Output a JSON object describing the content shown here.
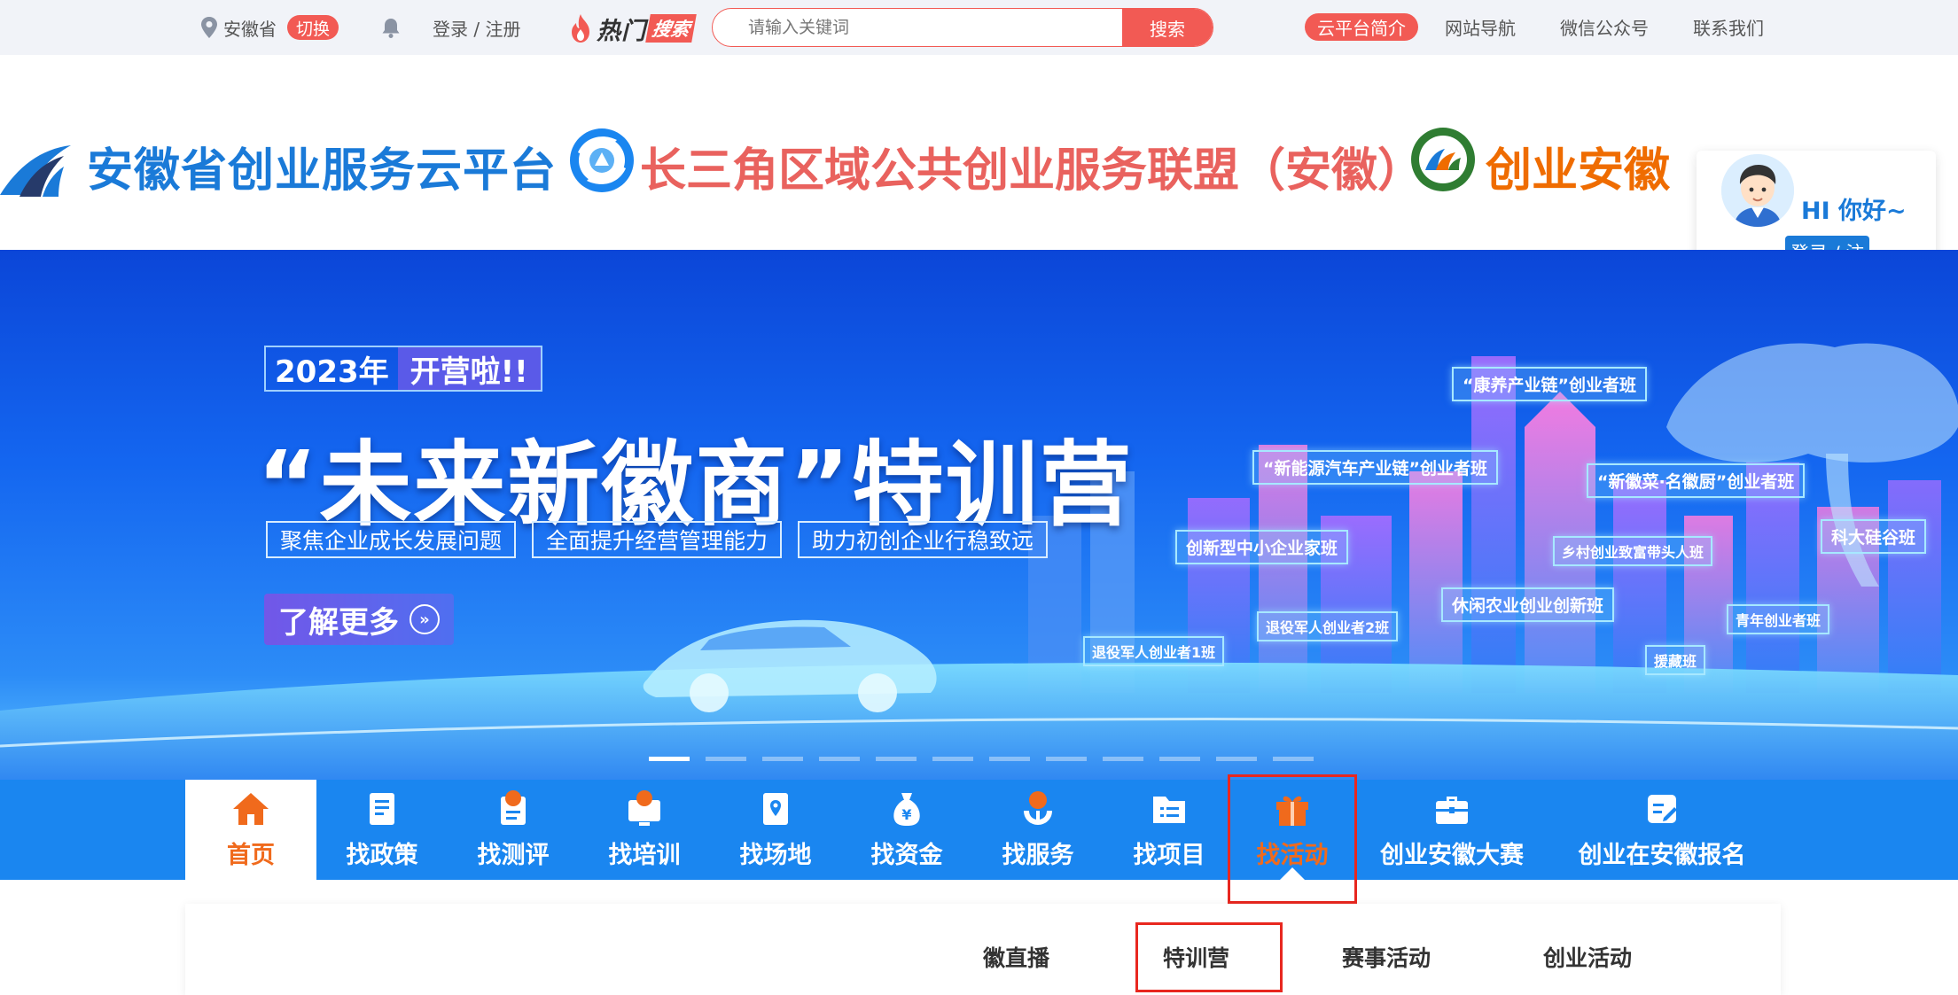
{
  "topbar": {
    "location": "安徽省",
    "switch_label": "切换",
    "login_label": "登录 / 注册",
    "hot_label": "热门",
    "hot_tag": "搜索",
    "search_placeholder": "请输入关键词",
    "search_button": "搜索",
    "intro_label": "云平台简介",
    "links": [
      "网站导航",
      "微信公众号",
      "联系我们"
    ]
  },
  "header": {
    "brand_1": "安徽省创业服务云平台",
    "brand_2": "长三角区域公共创业服务联盟（安徽）",
    "brand_3": "创业安徽",
    "greeting": "HI 你好~",
    "card_login": "登录 / 注"
  },
  "banner": {
    "year": "2023年",
    "open": "开营啦!!",
    "title": "“未来新徽商”特训营",
    "tags": [
      "聚焦企业成长发展问题",
      "全面提升经营管理能力",
      "助力初创企业行稳致远"
    ],
    "more": "了解更多",
    "classes": [
      "“康养产业链”创业者班",
      "“新能源汽车产业链”创业者班",
      "“新徽菜·名徽厨”创业者班",
      "创新型中小企业家班",
      "乡村创业致富带头人班",
      "科大硅谷班",
      "休闲农业创业创新班",
      "退役军人创业者2班",
      "青年创业者班",
      "退役军人创业者1班",
      "援藏班"
    ],
    "slide_count": 12,
    "active_slide": 0
  },
  "nav": {
    "items": [
      "首页",
      "找政策",
      "找测评",
      "找培训",
      "找场地",
      "找资金",
      "找服务",
      "找项目",
      "找活动",
      "创业安徽大赛",
      "创业在安徽报名"
    ],
    "active": "找活动"
  },
  "subnav": {
    "items": [
      "徽直播",
      "特训营",
      "赛事活动",
      "创业活动"
    ],
    "selected": "特训营"
  },
  "colors": {
    "accent_red": "#f25a54",
    "brand_blue": "#1a7ad8",
    "nav_blue": "#1a86f0",
    "active_orange": "#f06a1c",
    "highlight_box": "#e8271f"
  }
}
